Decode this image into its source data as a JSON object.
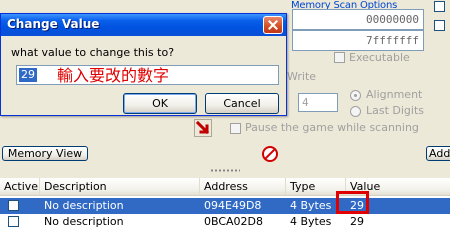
{
  "memory_scan": {
    "group_label": "Memory Scan Options",
    "start_value": "00000000",
    "stop_value": "7fffffff",
    "executable_label": "Executable",
    "writable_label": "Write",
    "alignment_label": "Alignment",
    "last_digits_label": "Last Digits",
    "alignment_value": "4",
    "pause_label": "Pause the game while scanning",
    "right_edge_button": "Add"
  },
  "toolbar": {
    "memory_view_label": "Memory View"
  },
  "dialog": {
    "title": "Change Value",
    "question": "what value to change this to?",
    "value": "29",
    "annotation": "輸入要改的數字",
    "ok_label": "OK",
    "cancel_label": "Cancel"
  },
  "table": {
    "columns": [
      "Active",
      "Description",
      "Address",
      "Type",
      "Value"
    ],
    "rows": [
      {
        "description": "No description",
        "address": "094E49D8",
        "type": "4 Bytes",
        "value": "29",
        "selected": true
      },
      {
        "description": "No description",
        "address": "0BCA02D8",
        "type": "4 Bytes",
        "value": "29",
        "selected": false
      }
    ]
  },
  "colors": {
    "title_bar": "#0A5FEA",
    "selection": "#316AC5",
    "annotation_red": "#E00000",
    "window_bg": "#ECE9D8"
  }
}
